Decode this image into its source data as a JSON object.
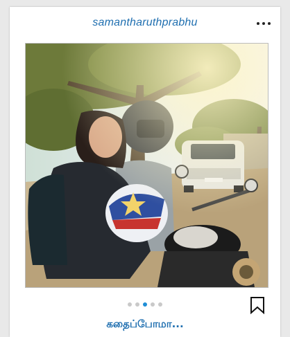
{
  "post": {
    "username": "samantharuthprabhu",
    "caption": "கதைப்போமா...",
    "pager": {
      "total": 5,
      "active_index": 2
    }
  },
  "icons": {
    "more": "more-options-icon",
    "bookmark": "bookmark-icon"
  },
  "colors": {
    "username": "#1f6fb0",
    "caption": "#1f6fb0",
    "pager_active": "#1f8ed6",
    "pager_inactive": "#c9c9c9"
  }
}
